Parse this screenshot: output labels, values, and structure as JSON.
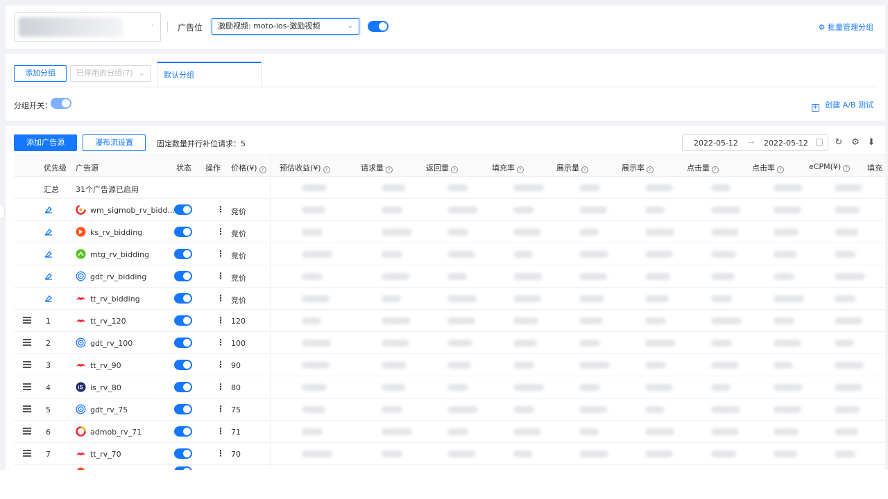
{
  "header": {
    "slot_label": "广告位",
    "slot_value": "激励视频: moto-ios-激励视频",
    "batch_link": "批量管理分组",
    "app_select_dot": "·"
  },
  "groups": {
    "add_button": "添加分组",
    "disabled_select": "已停用的分组(7)",
    "active_tab": "默认分组",
    "switch_label": "分组开关：",
    "ab_link": "创建 A/B 测试"
  },
  "toolbar": {
    "add_source": "添加广告源",
    "waterfall": "瀑布流设置",
    "fixed_text": "固定数量并行补位请求：5",
    "date_start": "2022-05-12",
    "date_end": "2022-05-12",
    "date_arrow": "→"
  },
  "table": {
    "headers": {
      "priority": "优先级",
      "source": "广告源",
      "status": "状态",
      "operation": "操作",
      "price": "价格(¥)",
      "revenue": "预估收益(¥)",
      "requests": "请求量",
      "returns": "返回量",
      "fill_rate": "填充率",
      "impressions": "展示量",
      "show_rate": "展示率",
      "clicks": "点击量",
      "ctr": "点击率",
      "ecpm": "eCPM(¥)",
      "fill_more": "填充"
    },
    "summary": {
      "label": "汇总",
      "enabled": "31个广告源已启用"
    },
    "rows": [
      {
        "priority": "",
        "name": "wm_sigmob_rv_bidd...",
        "price": "竞价"
      },
      {
        "priority": "",
        "name": "ks_rv_bidding",
        "price": "竞价"
      },
      {
        "priority": "",
        "name": "mtg_rv_bidding",
        "price": "竞价"
      },
      {
        "priority": "",
        "name": "gdt_rv_bidding",
        "price": "竞价"
      },
      {
        "priority": "",
        "name": "tt_rv_bidding",
        "price": "竞价"
      },
      {
        "priority": "1",
        "name": "tt_rv_120",
        "price": "120"
      },
      {
        "priority": "2",
        "name": "gdt_rv_100",
        "price": "100"
      },
      {
        "priority": "3",
        "name": "tt_rv_90",
        "price": "90"
      },
      {
        "priority": "4",
        "name": "is_rv_80",
        "price": "80"
      },
      {
        "priority": "5",
        "name": "gdt_rv_75",
        "price": "75"
      },
      {
        "priority": "6",
        "name": "admob_rv_71",
        "price": "71"
      },
      {
        "priority": "7",
        "name": "tt_rv_70",
        "price": "70"
      }
    ],
    "more_symbol": "⋮"
  },
  "icons": {
    "refresh": "↻",
    "setting": "⚙",
    "download": "⬇",
    "gear": "⚙",
    "question": "?",
    "chevron": "⌄",
    "plus": "+"
  },
  "colors": {
    "primary": "#1677ff",
    "sigmob": "#f5222d",
    "kuaishou": "#fa541c",
    "mintegral": "#52c41a",
    "gdt": "#1677ff",
    "toutiao": "#f5222d",
    "ironsource": "#1d2a6b",
    "admob": "#f5a623"
  }
}
